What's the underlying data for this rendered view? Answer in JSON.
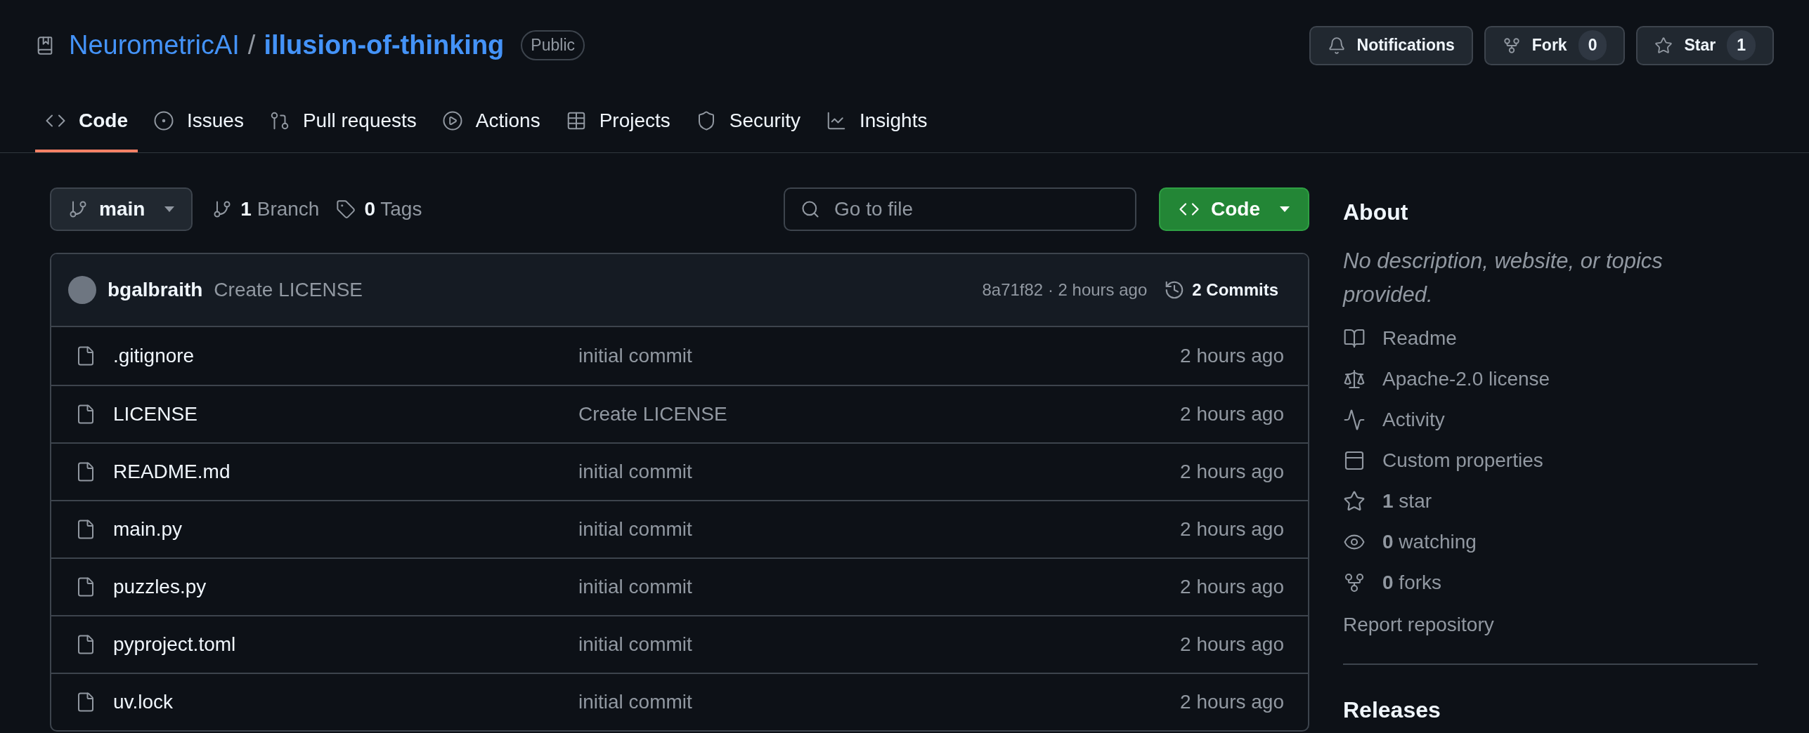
{
  "repo": {
    "owner": "NeurometricAI",
    "separator": "/",
    "name": "illusion-of-thinking",
    "visibility": "Public"
  },
  "actions": [
    {
      "kind": "notifications",
      "label": "Notifications"
    },
    {
      "kind": "fork",
      "label": "Fork",
      "count": "0"
    },
    {
      "kind": "star",
      "label": "Star",
      "count": "1"
    }
  ],
  "tabs": [
    {
      "kind": "code",
      "label": "Code",
      "selected": true
    },
    {
      "kind": "issues",
      "label": "Issues",
      "selected": false
    },
    {
      "kind": "pulls",
      "label": "Pull requests",
      "selected": false
    },
    {
      "kind": "actions",
      "label": "Actions",
      "selected": false
    },
    {
      "kind": "projects",
      "label": "Projects",
      "selected": false
    },
    {
      "kind": "security",
      "label": "Security",
      "selected": false
    },
    {
      "kind": "insights",
      "label": "Insights",
      "selected": false
    }
  ],
  "branch_bar": {
    "branch": "main",
    "branches": "**1** Branch",
    "tags": "**0** Tags",
    "search": {
      "placeholder": "Go to file"
    },
    "code_button": "Code"
  },
  "latest_commit": {
    "author": "bgalbraith",
    "message": "Create LICENSE",
    "hash_time": "8a71f82 · 2 hours ago",
    "commits": "2 Commits"
  },
  "files": [
    {
      "name": ".gitignore",
      "message": "initial commit",
      "time": "2 hours ago"
    },
    {
      "name": "LICENSE",
      "message": "Create LICENSE",
      "time": "2 hours ago"
    },
    {
      "name": "README.md",
      "message": "initial commit",
      "time": "2 hours ago"
    },
    {
      "name": "main.py",
      "message": "initial commit",
      "time": "2 hours ago"
    },
    {
      "name": "puzzles.py",
      "message": "initial commit",
      "time": "2 hours ago"
    },
    {
      "name": "pyproject.toml",
      "message": "initial commit",
      "time": "2 hours ago"
    },
    {
      "name": "uv.lock",
      "message": "initial commit",
      "time": "2 hours ago"
    }
  ],
  "about": {
    "title": "About",
    "description": "No description, website, or topics provided.",
    "items": [
      {
        "kind": "readme",
        "label": "Readme"
      },
      {
        "kind": "license",
        "label": "Apache-2.0 license"
      },
      {
        "kind": "activity",
        "label": "Activity"
      },
      {
        "kind": "properties",
        "label": "Custom properties"
      },
      {
        "kind": "stars",
        "label": "**1** star"
      },
      {
        "kind": "watching",
        "label": "**0** watching"
      },
      {
        "kind": "forks",
        "label": "**0** forks"
      }
    ],
    "report": "Report repository"
  },
  "releases": {
    "title": "Releases"
  }
}
